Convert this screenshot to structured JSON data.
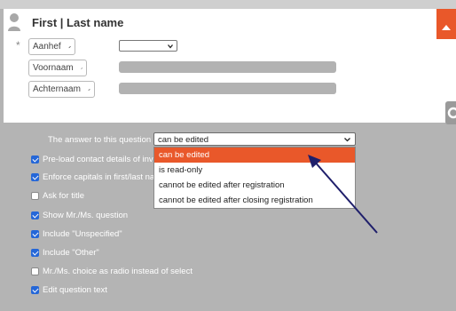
{
  "header": {
    "title": "First | Last name"
  },
  "form": {
    "required_marker": "*",
    "fields": [
      {
        "label": "Aanhef"
      },
      {
        "label": "Voornaam"
      },
      {
        "label": "Achternaam"
      }
    ]
  },
  "settings": {
    "question_label": "The answer to this question",
    "answer_select": {
      "value": "can be edited",
      "options": [
        "can be edited",
        "is read-only",
        "cannot be edited after registration",
        "cannot be edited after closing registration"
      ]
    },
    "checkboxes": [
      {
        "label": "Pre-load contact details of inv",
        "checked": true
      },
      {
        "label": "Enforce capitals in first/last nar",
        "checked": true
      },
      {
        "label": "Ask for title",
        "checked": false
      },
      {
        "label": "Show Mr./Ms. question",
        "checked": true
      },
      {
        "label": "Include \"Unspecified\"",
        "checked": true
      },
      {
        "label": "Include \"Other\"",
        "checked": true
      },
      {
        "label": "Mr./Ms. choice as radio instead of select",
        "checked": false
      },
      {
        "label": "Edit question text",
        "checked": true
      }
    ]
  },
  "colors": {
    "accent": "#e9582a",
    "checkbox": "#2567d8",
    "panel": "#b4b4b4",
    "annotation_arrow": "#1f1f6b"
  },
  "icons": [
    "person-icon",
    "pencil-icon",
    "chevron-down-icon",
    "gear-icon"
  ]
}
